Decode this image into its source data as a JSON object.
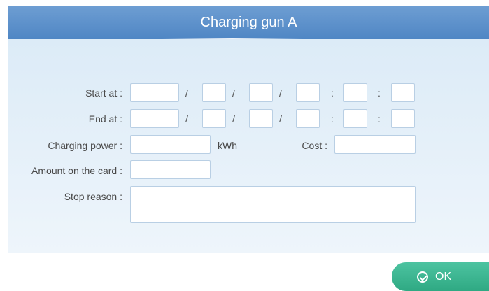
{
  "header": {
    "title": "Charging gun A"
  },
  "form": {
    "start_label": "Start at :",
    "end_label": "End at :",
    "power_label": "Charging power :",
    "power_unit": "kWh",
    "cost_label": "Cost :",
    "amount_label": "Amount on the card :",
    "reason_label": "Stop reason :",
    "date_sep": "/",
    "time_sep": ":",
    "start": {
      "year": "",
      "month": "",
      "day": "",
      "hour": "",
      "minute": "",
      "second": ""
    },
    "end": {
      "year": "",
      "month": "",
      "day": "",
      "hour": "",
      "minute": "",
      "second": ""
    },
    "power_value": "",
    "cost_value": "",
    "amount_value": "",
    "reason_value": ""
  },
  "ok_button": {
    "label": "OK",
    "icon": "check-circle-icon"
  },
  "colors": {
    "header": "#5b8fca",
    "panel": "#e3eff9",
    "ok": "#3db592"
  }
}
